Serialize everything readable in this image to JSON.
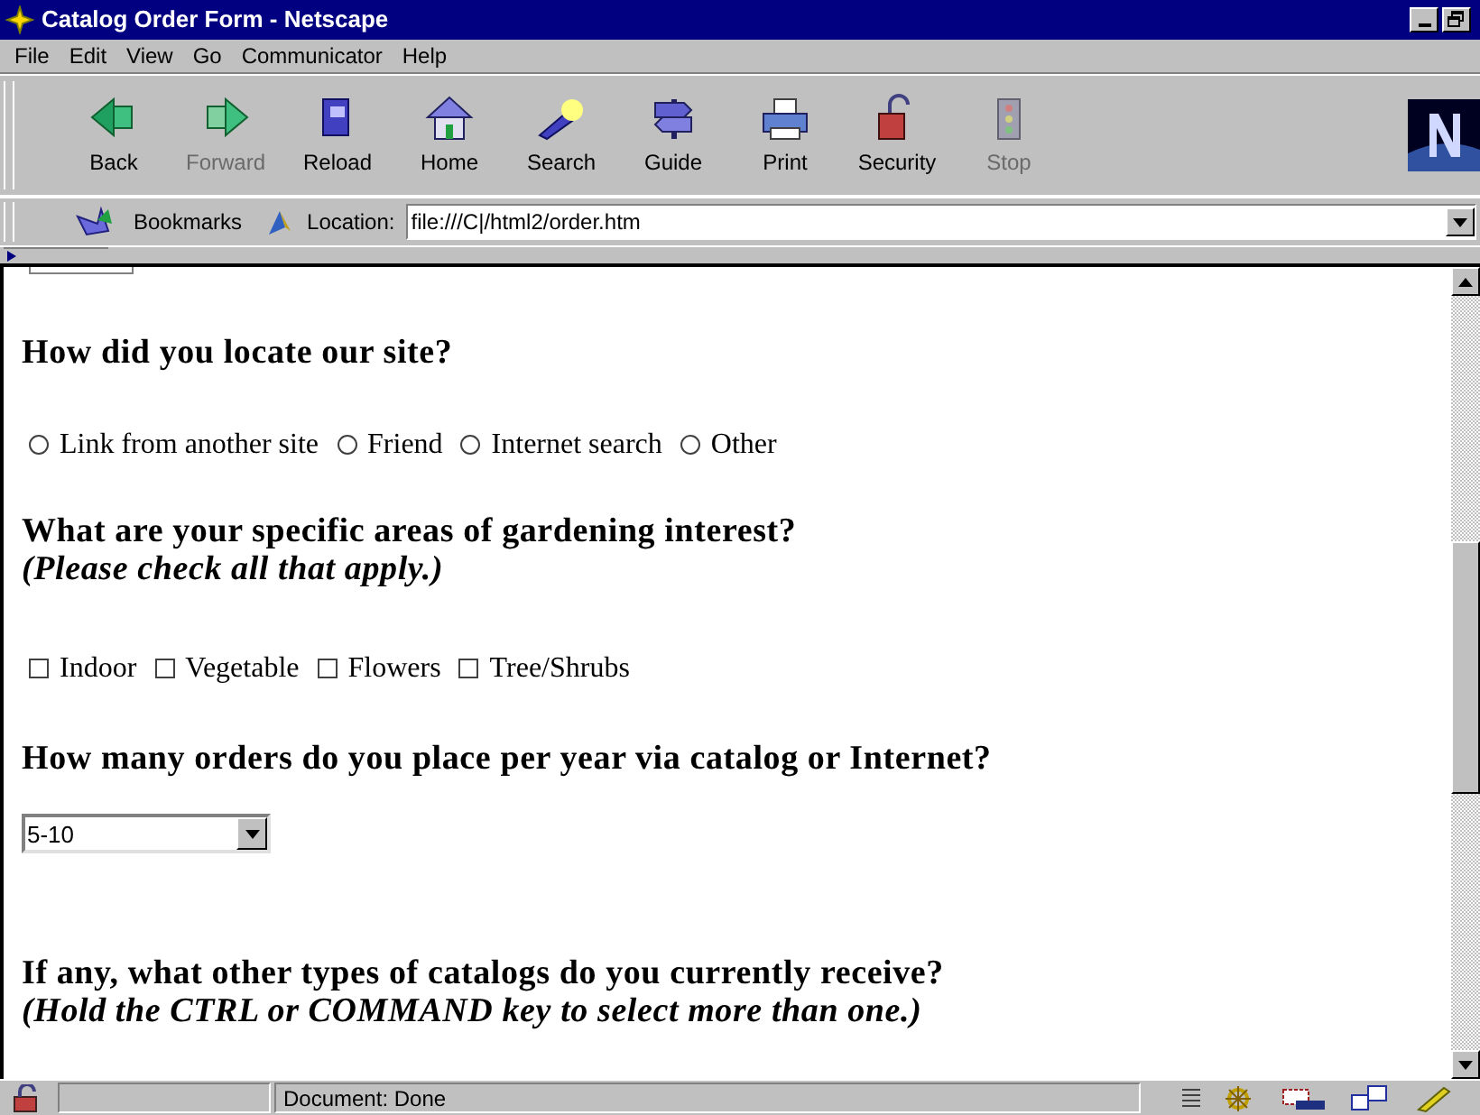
{
  "window": {
    "title": "Catalog Order Form - Netscape"
  },
  "menu": [
    "File",
    "Edit",
    "View",
    "Go",
    "Communicator",
    "Help"
  ],
  "toolbar": [
    {
      "label": "Back",
      "disabled": false
    },
    {
      "label": "Forward",
      "disabled": true
    },
    {
      "label": "Reload",
      "disabled": false
    },
    {
      "label": "Home",
      "disabled": false
    },
    {
      "label": "Search",
      "disabled": false
    },
    {
      "label": "Guide",
      "disabled": false
    },
    {
      "label": "Print",
      "disabled": false
    },
    {
      "label": "Security",
      "disabled": false
    },
    {
      "label": "Stop",
      "disabled": true
    }
  ],
  "location_bar": {
    "bookmarks": "Bookmarks",
    "label": "Location:",
    "url": "file:///C|/html2/order.htm"
  },
  "form": [
    {
      "kind": "radio",
      "question": "How did you locate our site?",
      "options": [
        {
          "label": "Link from another site",
          "selected": false
        },
        {
          "label": "Friend",
          "selected": false
        },
        {
          "label": "Internet search",
          "selected": false
        },
        {
          "label": "Other",
          "selected": false
        }
      ]
    },
    {
      "kind": "checkbox",
      "question": "What are your specific areas of gardening interest?",
      "note": "(Please check all that apply.)",
      "options": [
        {
          "label": "Indoor",
          "checked": false
        },
        {
          "label": "Vegetable",
          "checked": false
        },
        {
          "label": "Flowers",
          "checked": false
        },
        {
          "label": "Tree/Shrubs",
          "checked": false
        }
      ]
    },
    {
      "kind": "select",
      "question": "How many orders do you place per year via catalog or Internet?",
      "value": "5-10"
    },
    {
      "kind": "heading",
      "question": "If any, what other types of catalogs do you currently receive?",
      "note": "(Hold the CTRL or COMMAND key to select more than one.)"
    }
  ],
  "status_bar": {
    "text": "Document: Done"
  }
}
